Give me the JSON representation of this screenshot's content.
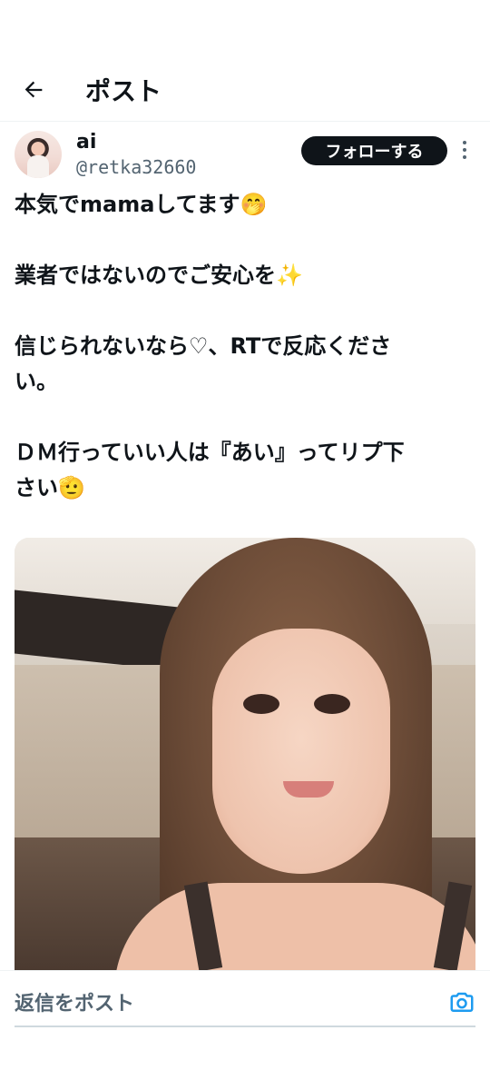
{
  "header": {
    "title": "ポスト"
  },
  "author": {
    "display_name": "ai",
    "handle": "@retka32660",
    "follow_label": "フォローする"
  },
  "tweet": {
    "lines": [
      "本気でmamaしてます🤭",
      "業者ではないのでご安心を✨",
      "信じられないなら♡、RTで反応くださ",
      "い。",
      "ＤＭ行っていい人は『あい』ってリプ下",
      "さい🫡"
    ]
  },
  "reply": {
    "placeholder": "返信をポスト"
  },
  "icons": {
    "back": "arrow-left-icon",
    "more": "more-vertical-icon",
    "camera": "camera-icon"
  },
  "colors": {
    "text_primary": "#0f1419",
    "text_secondary": "#536471",
    "accent": "#1d9bf0",
    "follow_bg": "#0f1419"
  }
}
